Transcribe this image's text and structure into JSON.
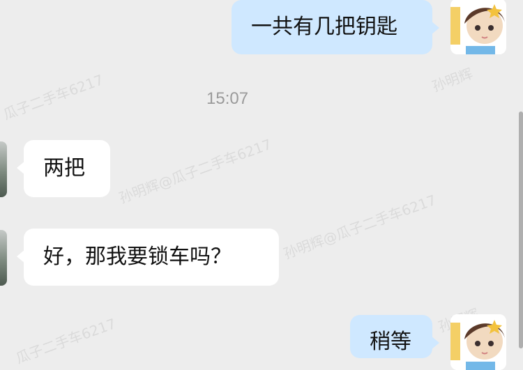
{
  "watermark": {
    "text": "孙明辉@瓜子二手车6217",
    "short": "瓜子二手车6217",
    "short_name": "孙明辉"
  },
  "timestamp": {
    "label": "15:07"
  },
  "messages": [
    {
      "id": "msg1",
      "side": "self",
      "text": "一共有几把钥匙"
    },
    {
      "id": "msg2",
      "side": "other",
      "text": "两把"
    },
    {
      "id": "msg3",
      "side": "other",
      "text": "好，那我要锁车吗？"
    },
    {
      "id": "msg4",
      "side": "self",
      "text": "稍等"
    }
  ],
  "ui": {
    "bubble_out_color": "#cfe8ff",
    "bubble_in_color": "#ffffff",
    "background_color": "#ededed",
    "timestamp_color": "#9a9a9a"
  },
  "icons": {
    "avatar_self": "cartoon-boy-avatar",
    "avatar_other": "photo-avatar"
  }
}
